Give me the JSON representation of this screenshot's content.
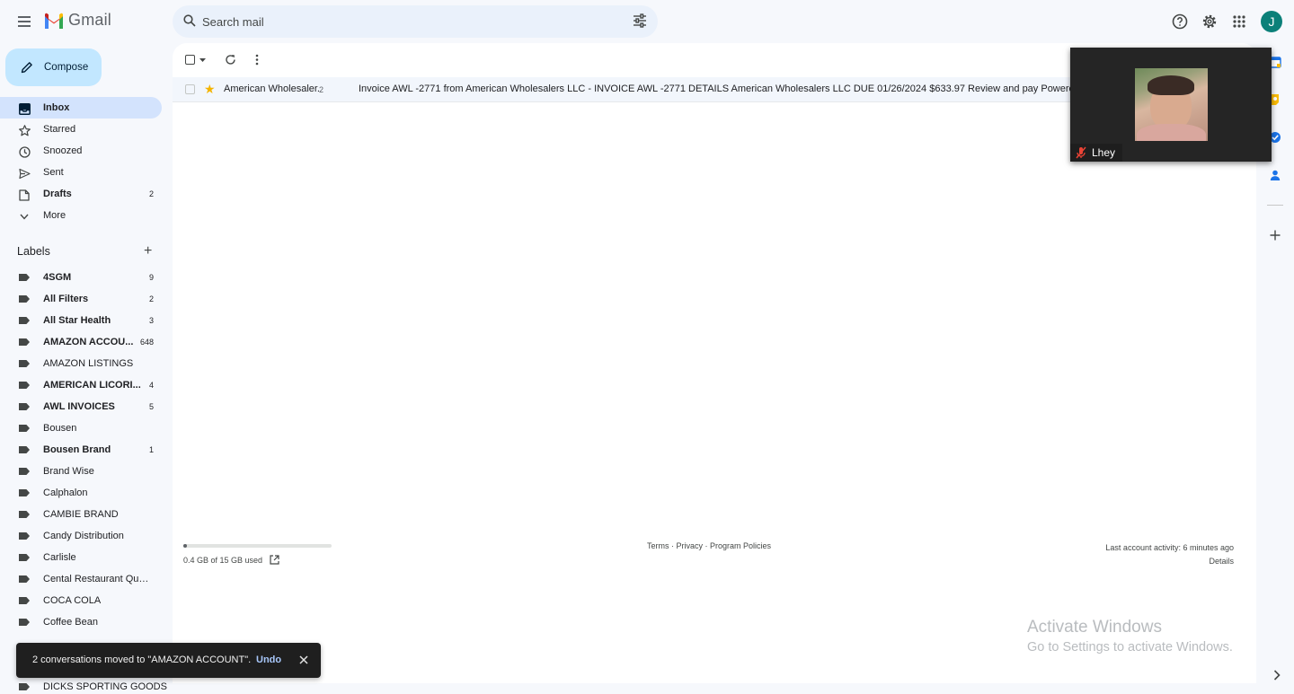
{
  "app": {
    "name": "Gmail"
  },
  "search": {
    "placeholder": "Search mail"
  },
  "user": {
    "avatar_letter": "J",
    "avatar_color": "#0b8079"
  },
  "compose": {
    "label": "Compose"
  },
  "nav": [
    {
      "label": "Inbox",
      "icon": "inbox-icon",
      "count": "",
      "active": true,
      "bold": true
    },
    {
      "label": "Starred",
      "icon": "star-icon",
      "count": "",
      "active": false,
      "bold": false
    },
    {
      "label": "Snoozed",
      "icon": "clock-icon",
      "count": "",
      "active": false,
      "bold": false
    },
    {
      "label": "Sent",
      "icon": "send-icon",
      "count": "",
      "active": false,
      "bold": false
    },
    {
      "label": "Drafts",
      "icon": "draft-icon",
      "count": "2",
      "active": false,
      "bold": true
    },
    {
      "label": "More",
      "icon": "chevron-down-icon",
      "count": "",
      "active": false,
      "bold": false
    }
  ],
  "labels_section": {
    "title": "Labels"
  },
  "labels": [
    {
      "label": "4SGM",
      "count": "9",
      "bold": true
    },
    {
      "label": "All Filters",
      "count": "2",
      "bold": true
    },
    {
      "label": "All Star Health",
      "count": "3",
      "bold": true
    },
    {
      "label": "AMAZON ACCOU...",
      "count": "648",
      "bold": true
    },
    {
      "label": "AMAZON LISTINGS",
      "count": "",
      "bold": false
    },
    {
      "label": "AMERICAN LICORI...",
      "count": "4",
      "bold": true
    },
    {
      "label": "AWL INVOICES",
      "count": "5",
      "bold": true
    },
    {
      "label": "Bousen",
      "count": "",
      "bold": false
    },
    {
      "label": "Bousen Brand",
      "count": "1",
      "bold": true
    },
    {
      "label": "Brand Wise",
      "count": "",
      "bold": false
    },
    {
      "label": "Calphalon",
      "count": "",
      "bold": false
    },
    {
      "label": "CAMBIE BRAND",
      "count": "",
      "bold": false
    },
    {
      "label": "Candy Distribution",
      "count": "",
      "bold": false
    },
    {
      "label": "Carlisle",
      "count": "",
      "bold": false
    },
    {
      "label": "Cental Restaurant Quot...",
      "count": "",
      "bold": false
    },
    {
      "label": "COCA COLA",
      "count": "",
      "bold": false
    },
    {
      "label": "Coffee Bean",
      "count": "",
      "bold": false
    }
  ],
  "bottom_label": "DICKS SPORTING GOODS",
  "email": {
    "from": "American Wholesaler.",
    "thread_count": "2",
    "subject": "Invoice AWL -2771 from American Wholesalers LLC - INVOICE AWL -2771 DETAILS American Wholesalers LLC DUE 01/26/2024 $633.97 Review and pay Powered by Quic",
    "starred": true
  },
  "footer": {
    "storage": "0.4 GB of 15 GB used",
    "storage_fraction": 0.027,
    "links": "Terms · Privacy · Program Policies",
    "activity": "Last account activity: 6 minutes ago",
    "details": "Details"
  },
  "watermark": {
    "title": "Activate Windows",
    "subtitle": "Go to Settings to activate Windows."
  },
  "video": {
    "name": "Lhey"
  },
  "snackbar": {
    "message": "2 conversations moved to \"AMAZON ACCOUNT\".",
    "undo": "Undo"
  }
}
